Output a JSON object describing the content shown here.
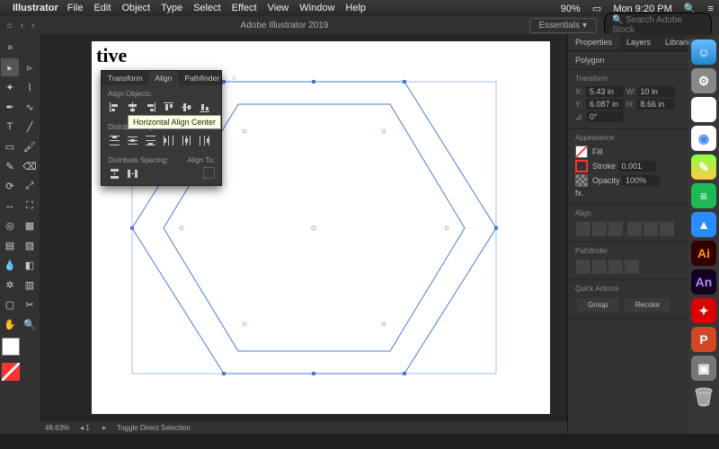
{
  "menubar": {
    "apple": "",
    "app": "Illustrator",
    "items": [
      "File",
      "Edit",
      "Object",
      "Type",
      "Select",
      "Effect",
      "View",
      "Window",
      "Help"
    ],
    "status": {
      "battery": "90%",
      "wifi": "",
      "clock": "Mon 9:20 PM"
    }
  },
  "apptitle": {
    "title": "Adobe Illustrator 2019",
    "workspace": "Essentials",
    "search_placeholder": "Search Adobe Stock"
  },
  "align_panel": {
    "tabs": [
      "Transform",
      "Align",
      "Pathfinder"
    ],
    "active_tab": "Align",
    "sec_align": "Align Objects:",
    "sec_distribute": "Distribute Objects:",
    "tooltip": "Horizontal Align Center",
    "sec_spacing": "Distribute Spacing:",
    "align_to_label": "Align To:"
  },
  "properties": {
    "tabs": [
      "Properties",
      "Layers",
      "Libraries"
    ],
    "active_tab": "Properties",
    "selection": "Polygon",
    "transform": {
      "header": "Transform",
      "x": "5.43 in",
      "y": "6.087 in",
      "w": "10 in",
      "h": "8.66 in",
      "angle": "0°"
    },
    "appearance": {
      "header": "Appearance",
      "fill": "Fill",
      "stroke": "Stroke",
      "stroke_val": "0.001",
      "opacity": "Opacity",
      "opacity_val": "100%"
    },
    "align": {
      "header": "Align"
    },
    "pathfinder": {
      "header": "Pathfinder"
    },
    "quickactions": {
      "header": "Quick Actions",
      "group": "Group",
      "recolor": "Recolor"
    }
  },
  "brand_text": "tive",
  "status": {
    "zoom": "48.63%",
    "artboard": "1",
    "tool": "Toggle Direct Selection"
  },
  "colors": {
    "accent": "#4b7bd6",
    "bg_dark": "#323232"
  }
}
